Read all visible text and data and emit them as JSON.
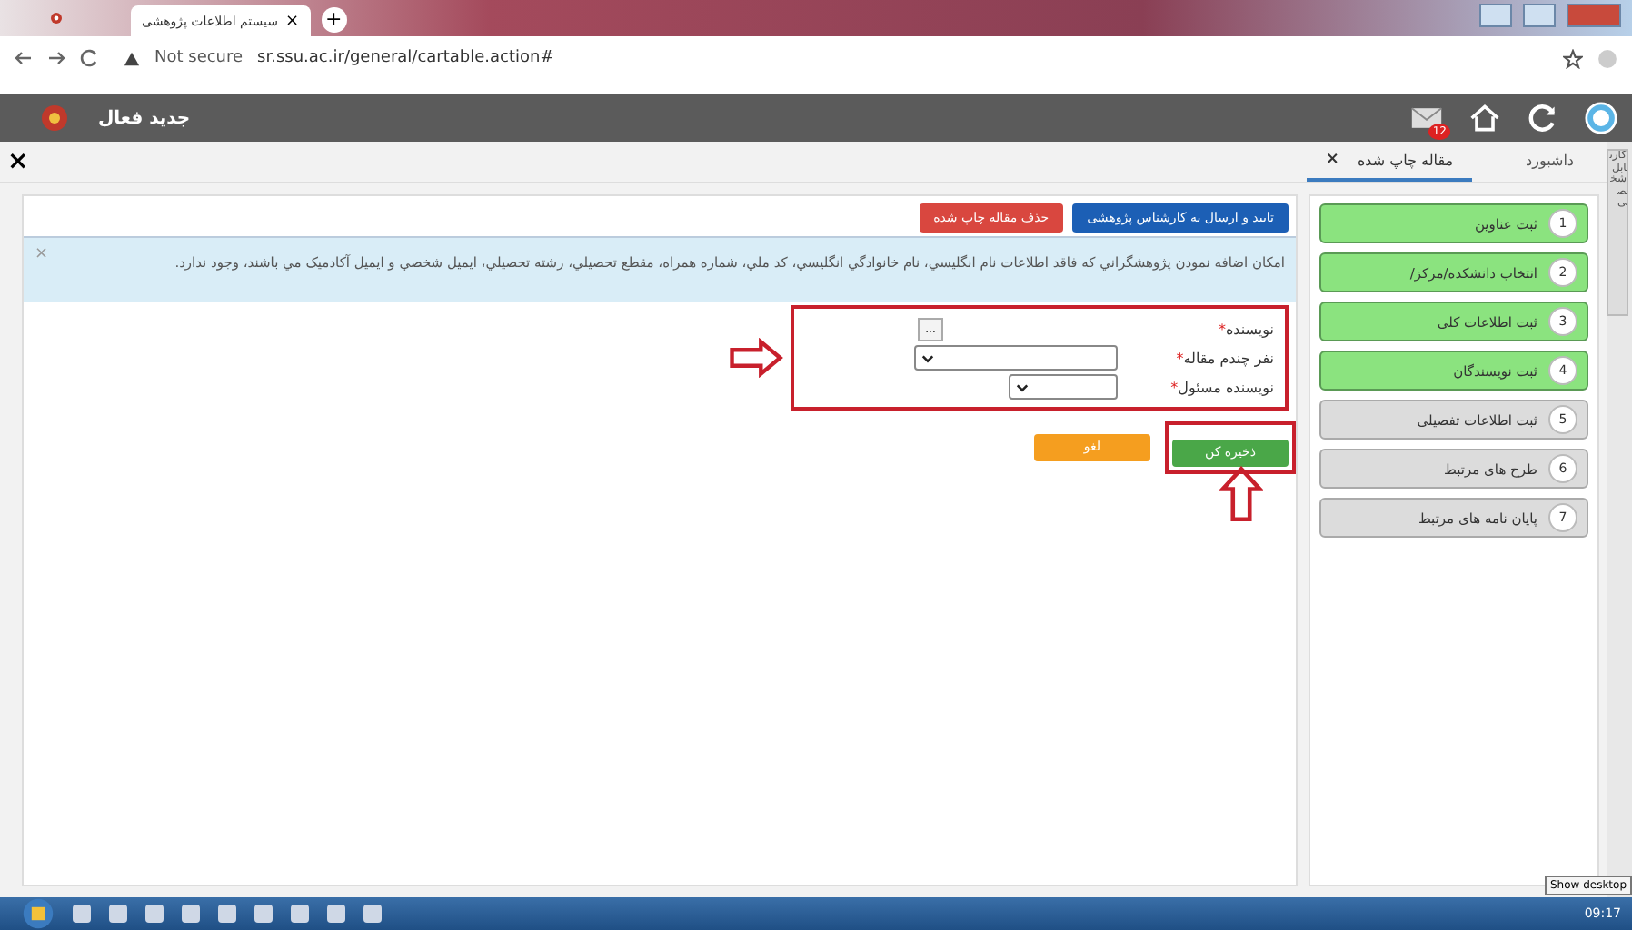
{
  "browser": {
    "tab_title": "سیستم اطلاعات پژوهشی",
    "tab_close": "×",
    "new_tab": "+",
    "security": "Not secure",
    "url": "sr.ssu.ac.ir/general/cartable.action#"
  },
  "app_header": {
    "title": "جدید فعال",
    "badge": "12"
  },
  "close_panel": "×",
  "tabs": [
    {
      "label": "داشبورد",
      "selected": false,
      "closable": false
    },
    {
      "label": "مقاله چاپ شده",
      "selected": true,
      "closable": true
    }
  ],
  "tab_close": "×",
  "side_tab": "کارتابل شخصی",
  "action_buttons": [
    {
      "label": "تایید و ارسال به کارشناس پژوهشی",
      "kind": "primary"
    },
    {
      "label": "حذف مقاله چاپ شده",
      "kind": "danger"
    }
  ],
  "alert": {
    "text": "امکان اضافه نمودن پژوهشگراني که فاقد اطلاعات نام انگليسي، نام خانوادگي انگليسي، کد ملي، شماره همراه، مقطع تحصيلي، رشته تحصيلي، ايميل شخصي و ايميل آکادميک مي باشند، وجود ندارد.",
    "close": "×"
  },
  "form": [
    {
      "label": "نویسنده",
      "mark": "*",
      "kind": "picker",
      "button": "..."
    },
    {
      "label": "نفر چندم مقاله",
      "mark": "*",
      "kind": "select-wide"
    },
    {
      "label": "نویسنده مسئول",
      "mark": "*",
      "kind": "select"
    }
  ],
  "form_buttons": [
    {
      "label": "ذخیره کن",
      "kind": "success"
    },
    {
      "label": "لغو",
      "kind": "warning"
    }
  ],
  "steps": [
    {
      "number": "1",
      "label": "ثبت عناوین",
      "done": true
    },
    {
      "number": "2",
      "label": "انتخاب دانشکده/مرکز/",
      "done": true
    },
    {
      "number": "3",
      "label": "ثبت اطلاعات کلی",
      "done": true
    },
    {
      "number": "4",
      "label": "ثبت نویسندگان",
      "done": true
    },
    {
      "number": "5",
      "label": "ثبت اطلاعات تفصیلی",
      "done": false
    },
    {
      "number": "6",
      "label": "طرح های مرتبط",
      "done": false
    },
    {
      "number": "7",
      "label": "پایان نامه های مرتبط",
      "done": false
    }
  ],
  "taskbar": {
    "tooltip": "Show desktop",
    "clock": "09:17"
  }
}
